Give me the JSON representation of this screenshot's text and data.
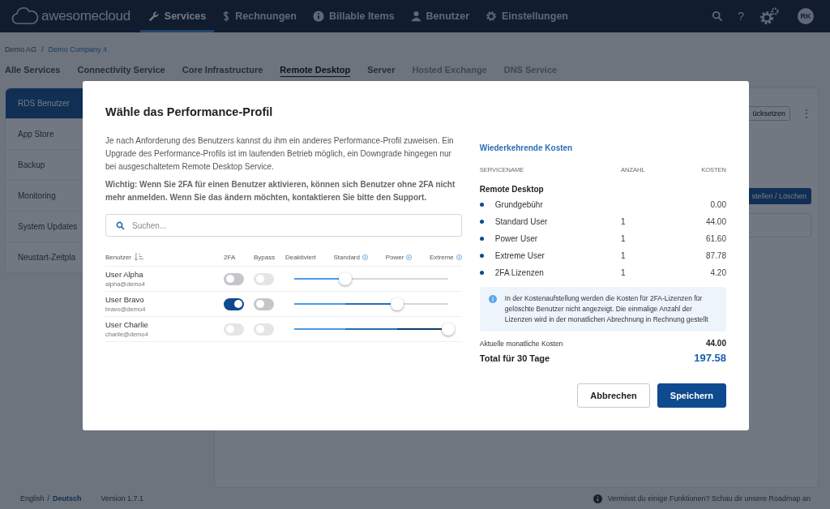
{
  "header": {
    "logo": "awesomecloud",
    "nav": [
      {
        "label": "Services",
        "selected": true
      },
      {
        "label": "Rechnungen",
        "selected": false
      },
      {
        "label": "Billable Items",
        "selected": false
      },
      {
        "label": "Benutzer",
        "selected": false
      },
      {
        "label": "Einstellungen",
        "selected": false
      }
    ],
    "help": "?",
    "avatar": "RK"
  },
  "breadcrumbs": {
    "separator": "/",
    "items": [
      "Demo AG",
      "Demo Company 4"
    ]
  },
  "service_tabs": [
    {
      "label": "Alle Services",
      "selected": false,
      "disabled": false
    },
    {
      "label": "Connectivity Service",
      "selected": false,
      "disabled": false
    },
    {
      "label": "Core Infrastructure",
      "selected": false,
      "disabled": false
    },
    {
      "label": "Remote Desktop",
      "selected": true,
      "disabled": false
    },
    {
      "label": "Server",
      "selected": false,
      "disabled": false
    },
    {
      "label": "Hosted Exchange",
      "selected": false,
      "disabled": true
    },
    {
      "label": "DNS Service",
      "selected": false,
      "disabled": true
    }
  ],
  "sidebar": {
    "items": [
      {
        "label": "RDS Benutzer",
        "selected": true
      },
      {
        "label": "App Store",
        "selected": false
      },
      {
        "label": "Backup",
        "selected": false
      },
      {
        "label": "Monitoring",
        "selected": false
      },
      {
        "label": "System Updates",
        "selected": false
      },
      {
        "label": "Neustart-Zeitpla",
        "selected": false
      }
    ]
  },
  "content": {
    "reset_button": "ücksetzen",
    "more": "⋮",
    "action_button": "stellen / Löschen"
  },
  "footer": {
    "separator": "/",
    "languages": [
      {
        "label": "English",
        "selected": false
      },
      {
        "label": "Deutsch",
        "selected": true
      }
    ],
    "version": "Version 1.7.1",
    "roadmap": "Vermisst du einige Funktionen? Schau dir unsere Roadmap an"
  },
  "dialog": {
    "title": "Wähle das Performance-Profil",
    "intro": "Je nach Anforderung des Benutzers kannst du ihm ein anderes Performance-Profil zuweisen. Ein Upgrade des Performance-Profils ist im laufenden Betrieb möglich, ein Downgrade hingegen nur bei ausgeschaltetem Remote Desktop Service.",
    "warning": "Wichtig: Wenn Sie 2FA für einen Benutzer aktivieren, können sich Benutzer ohne 2FA nicht mehr anmelden. Wenn Sie das ändern möchten, kontaktieren Sie bitte den Support.",
    "search": {
      "placeholder": "Suchen..."
    },
    "columns": {
      "user": "Benutzer",
      "twofa": "2FA",
      "bypass": "Bypass",
      "levels": [
        {
          "label": "Deaktiviert",
          "info": false
        },
        {
          "label": "Standard",
          "info": true
        },
        {
          "label": "Power",
          "info": true
        },
        {
          "label": "Extreme",
          "info": true
        }
      ]
    },
    "users": [
      {
        "name": "User Alpha",
        "login": "alpha@demo4",
        "twofa": {
          "on": false,
          "disabled": false
        },
        "bypass": {
          "on": false,
          "disabled": true
        },
        "level": 0.3333
      },
      {
        "name": "User Bravo",
        "login": "bravo@demo4",
        "twofa": {
          "on": true,
          "disabled": false
        },
        "bypass": {
          "on": false,
          "disabled": false
        },
        "level": 0.6667
      },
      {
        "name": "User Charlie",
        "login": "charlie@demo4",
        "twofa": {
          "on": false,
          "disabled": true
        },
        "bypass": {
          "on": false,
          "disabled": true
        },
        "level": 1
      }
    ],
    "costs": {
      "title": "Wiederkehrende Kosten",
      "columns": [
        "SERVICENAME",
        "ANZAHL",
        "KOSTEN"
      ],
      "group": "Remote Desktop",
      "rows": [
        {
          "name": "Grundgebühr",
          "count": "",
          "cost": "0.00"
        },
        {
          "name": "Standard User",
          "count": "1",
          "cost": "44.00"
        },
        {
          "name": "Power User",
          "count": "1",
          "cost": "61.60"
        },
        {
          "name": "Extreme User",
          "count": "1",
          "cost": "87.78"
        },
        {
          "name": "2FA Lizenzen",
          "count": "1",
          "cost": "4.20"
        }
      ],
      "note": "In der Kostenaufstellung werden die Kosten für 2FA-Lizenzen für gelöschte Benutzer nicht angezeigt. Die einmalige Anzahl der Lizenzen wird in der monatlichen Abrechnung in Rechnung gestellt",
      "monthly_label": "Aktuelle monatliche Kosten",
      "monthly": "44.00",
      "total_label": "Total für 30 Tage",
      "total": "197.58"
    },
    "buttons": [
      {
        "label": "Abbrechen",
        "kind": "secondary"
      },
      {
        "label": "Speichern",
        "kind": "primary"
      }
    ]
  }
}
